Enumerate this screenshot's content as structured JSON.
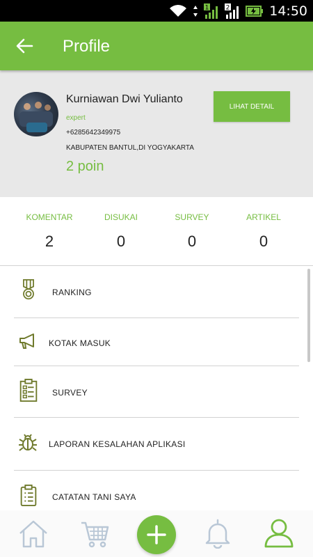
{
  "status_bar": {
    "time": "14:50",
    "sim1": "1",
    "sim2": "2"
  },
  "app_bar": {
    "title": "Profile"
  },
  "profile": {
    "name": "Kurniawan Dwi Yulianto",
    "role": "expert",
    "phone": "+6285642349975",
    "location": "KABUPATEN BANTUL,DI YOGYAKARTA",
    "points": "2 poin",
    "detail_button": "LIHAT DETAIL"
  },
  "stats": [
    {
      "label": "KOMENTAR",
      "value": "2"
    },
    {
      "label": "DISUKAI",
      "value": "0"
    },
    {
      "label": "SURVEY",
      "value": "0"
    },
    {
      "label": "ARTIKEL",
      "value": "0"
    }
  ],
  "menu": [
    {
      "label": "RANKING",
      "icon": "medal-icon"
    },
    {
      "label": "KOTAK MASUK",
      "icon": "megaphone-icon"
    },
    {
      "label": "SURVEY",
      "icon": "clipboard-survey-icon"
    },
    {
      "label": "LAPORAN KESALAHAN APLIKASI",
      "icon": "bug-icon"
    },
    {
      "label": "CATATAN TANI SAYA",
      "icon": "notes-icon"
    }
  ],
  "bottom_nav": [
    "home-icon",
    "cart-icon",
    "add-icon",
    "bell-icon",
    "user-icon"
  ],
  "colors": {
    "accent": "#76bd41",
    "icon_olive": "#6f7a2c",
    "nav_inactive": "#b9c7d6"
  }
}
